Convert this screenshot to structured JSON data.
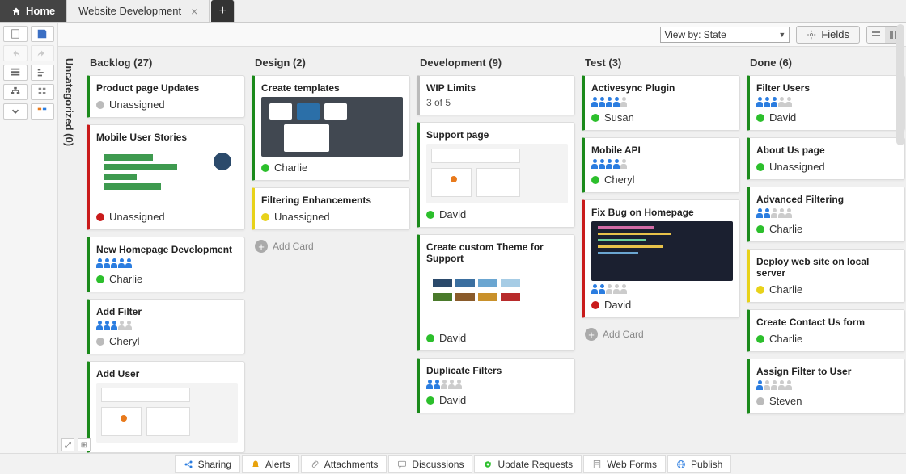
{
  "tabs": {
    "home": "Home",
    "doc": "Website Development"
  },
  "topbar": {
    "viewby": "View by: State",
    "fields": "Fields"
  },
  "uncategorized_label": "Uncategorized (0)",
  "columns": [
    {
      "id": "backlog",
      "title": "Backlog (27)",
      "add_card": false,
      "cards": [
        {
          "stripe": "green",
          "title": "Product page Updates",
          "people": null,
          "dot": "gray",
          "assignee": "Unassigned",
          "thumb": null
        },
        {
          "stripe": "red",
          "title": "Mobile User Stories",
          "people": null,
          "dot": "red",
          "assignee": "Unassigned",
          "thumb": "bars"
        },
        {
          "stripe": "green",
          "title": "New Homepage Development",
          "people": [
            1,
            1,
            1,
            1,
            1
          ],
          "dot": "green",
          "assignee": "Charlie",
          "thumb": null
        },
        {
          "stripe": "green",
          "title": "Add Filter",
          "people": [
            1,
            1,
            1,
            0,
            0
          ],
          "dot": "gray",
          "assignee": "Cheryl",
          "thumb": null
        },
        {
          "stripe": "green",
          "title": "Add User",
          "people": null,
          "dot": null,
          "assignee": null,
          "thumb": "wire"
        }
      ]
    },
    {
      "id": "design",
      "title": "Design (2)",
      "add_card": true,
      "cards": [
        {
          "stripe": "green",
          "title": "Create templates",
          "people": null,
          "dot": "green",
          "assignee": "Charlie",
          "thumb": "template"
        },
        {
          "stripe": "yellow",
          "title": "Filtering Enhancements",
          "people": null,
          "dot": "yellow",
          "assignee": "Unassigned",
          "thumb": null
        }
      ]
    },
    {
      "id": "development",
      "title": "Development (9)",
      "add_card": false,
      "cards": [
        {
          "stripe": "gray",
          "title": "WIP Limits",
          "subtitle": "3 of 5",
          "people": null,
          "dot": null,
          "assignee": null,
          "thumb": null
        },
        {
          "stripe": "green",
          "title": "Support page",
          "people": null,
          "dot": "green",
          "assignee": "David",
          "thumb": "wire"
        },
        {
          "stripe": "green",
          "title": "Create custom Theme for Support",
          "people": null,
          "dot": "green",
          "assignee": "David",
          "thumb": "palette"
        },
        {
          "stripe": "green",
          "title": "Duplicate Filters",
          "people": [
            1,
            1,
            0,
            0,
            0
          ],
          "dot": "green",
          "assignee": "David",
          "thumb": null
        }
      ]
    },
    {
      "id": "test",
      "title": "Test (3)",
      "add_card": true,
      "cards": [
        {
          "stripe": "green",
          "title": "Activesync Plugin",
          "people": [
            1,
            1,
            1,
            1,
            0
          ],
          "dot": "green",
          "assignee": "Susan",
          "thumb": null
        },
        {
          "stripe": "green",
          "title": "Mobile API",
          "people": [
            1,
            1,
            1,
            1,
            0
          ],
          "dot": "green",
          "assignee": "Cheryl",
          "thumb": null
        },
        {
          "stripe": "red",
          "title": "Fix Bug on Homepage",
          "people": [
            1,
            1,
            0,
            0,
            0
          ],
          "dot": "red",
          "assignee": "David",
          "thumb": "code"
        }
      ]
    },
    {
      "id": "done",
      "title": "Done (6)",
      "add_card": false,
      "cards": [
        {
          "stripe": "green",
          "title": "Filter Users",
          "people": [
            1,
            1,
            1,
            0,
            0
          ],
          "dot": "green",
          "assignee": "David",
          "thumb": null
        },
        {
          "stripe": "green",
          "title": "About Us page",
          "people": null,
          "dot": "green",
          "assignee": "Unassigned",
          "thumb": null
        },
        {
          "stripe": "green",
          "title": "Advanced Filtering",
          "people": [
            1,
            1,
            0,
            0,
            0
          ],
          "dot": "green",
          "assignee": "Charlie",
          "thumb": null
        },
        {
          "stripe": "yellow",
          "title": "Deploy web site on local server",
          "people": null,
          "dot": "yellow",
          "assignee": "Charlie",
          "thumb": null
        },
        {
          "stripe": "green",
          "title": "Create Contact Us form",
          "people": null,
          "dot": "green",
          "assignee": "Charlie",
          "thumb": null
        },
        {
          "stripe": "green",
          "title": "Assign Filter to User",
          "people": [
            1,
            0,
            0,
            0,
            0
          ],
          "dot": "gray",
          "assignee": "Steven",
          "thumb": null
        }
      ]
    }
  ],
  "add_card_label": "Add Card",
  "footer": [
    {
      "icon": "share",
      "label": "Sharing",
      "color": "#2b7de0"
    },
    {
      "icon": "bell",
      "label": "Alerts",
      "color": "#e8a20c"
    },
    {
      "icon": "clip",
      "label": "Attachments",
      "color": "#888"
    },
    {
      "icon": "chat",
      "label": "Discussions",
      "color": "#888"
    },
    {
      "icon": "refresh",
      "label": "Update Requests",
      "color": "#2cbf2c"
    },
    {
      "icon": "form",
      "label": "Web Forms",
      "color": "#888"
    },
    {
      "icon": "globe",
      "label": "Publish",
      "color": "#2b7de0"
    }
  ]
}
